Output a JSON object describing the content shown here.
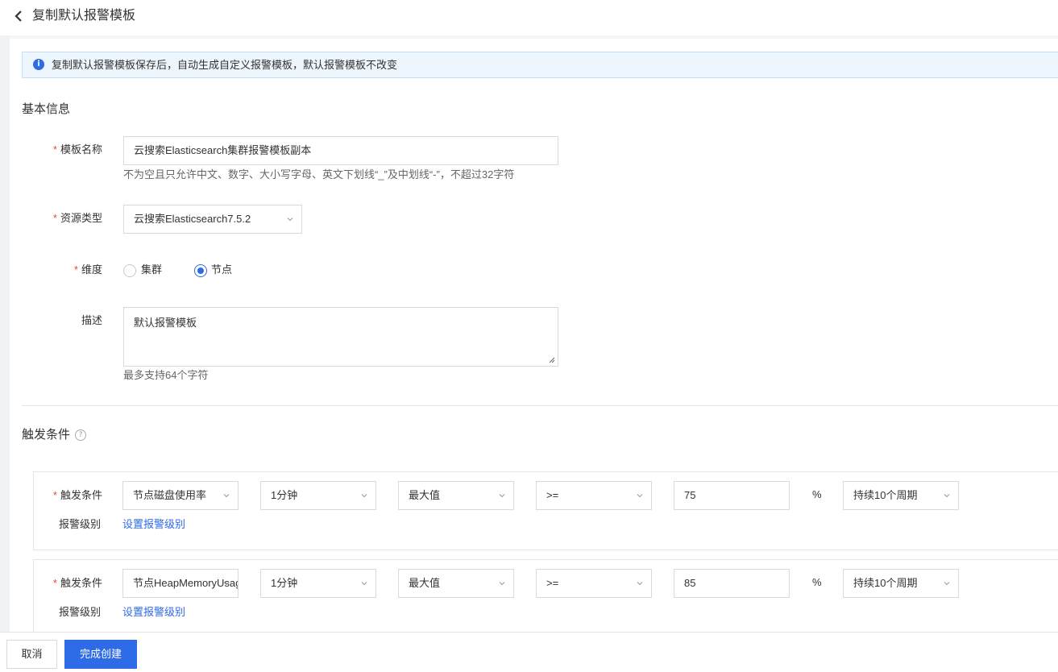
{
  "header": {
    "title": "复制默认报警模板"
  },
  "notice": {
    "text": "复制默认报警模板保存后，自动生成自定义报警模板，默认报警模板不改变"
  },
  "basic_info": {
    "section_title": "基本信息",
    "template_name": {
      "label": "模板名称",
      "value": "云搜索Elasticsearch集群报警模板副本",
      "hint": "不为空且只允许中文、数字、大小写字母、英文下划线“_”及中划线“-”，不超过32字符"
    },
    "resource_type": {
      "label": "资源类型",
      "value": "云搜索Elasticsearch7.5.2"
    },
    "dimension": {
      "label": "维度",
      "options": [
        "集群",
        "节点"
      ],
      "selected": "节点"
    },
    "description": {
      "label": "描述",
      "value": "默认报警模板",
      "hint": "最多支持64个字符"
    }
  },
  "trigger": {
    "section_title": "触发条件",
    "condition_label": "触发条件",
    "level_label": "报警级别",
    "set_level_link": "设置报警级别",
    "rules": [
      {
        "metric": "节点磁盘使用率",
        "period": "1分钟",
        "stat": "最大值",
        "operator": ">=",
        "threshold": "75",
        "unit": "%",
        "duration": "持续10个周期"
      },
      {
        "metric": "节点HeapMemoryUsage",
        "period": "1分钟",
        "stat": "最大值",
        "operator": ">=",
        "threshold": "85",
        "unit": "%",
        "duration": "持续10个周期"
      }
    ]
  },
  "footer": {
    "cancel": "取消",
    "submit": "完成创建"
  },
  "colors": {
    "primary": "#2e6be6",
    "required": "#e54545",
    "notice_bg": "#eef6fd"
  }
}
